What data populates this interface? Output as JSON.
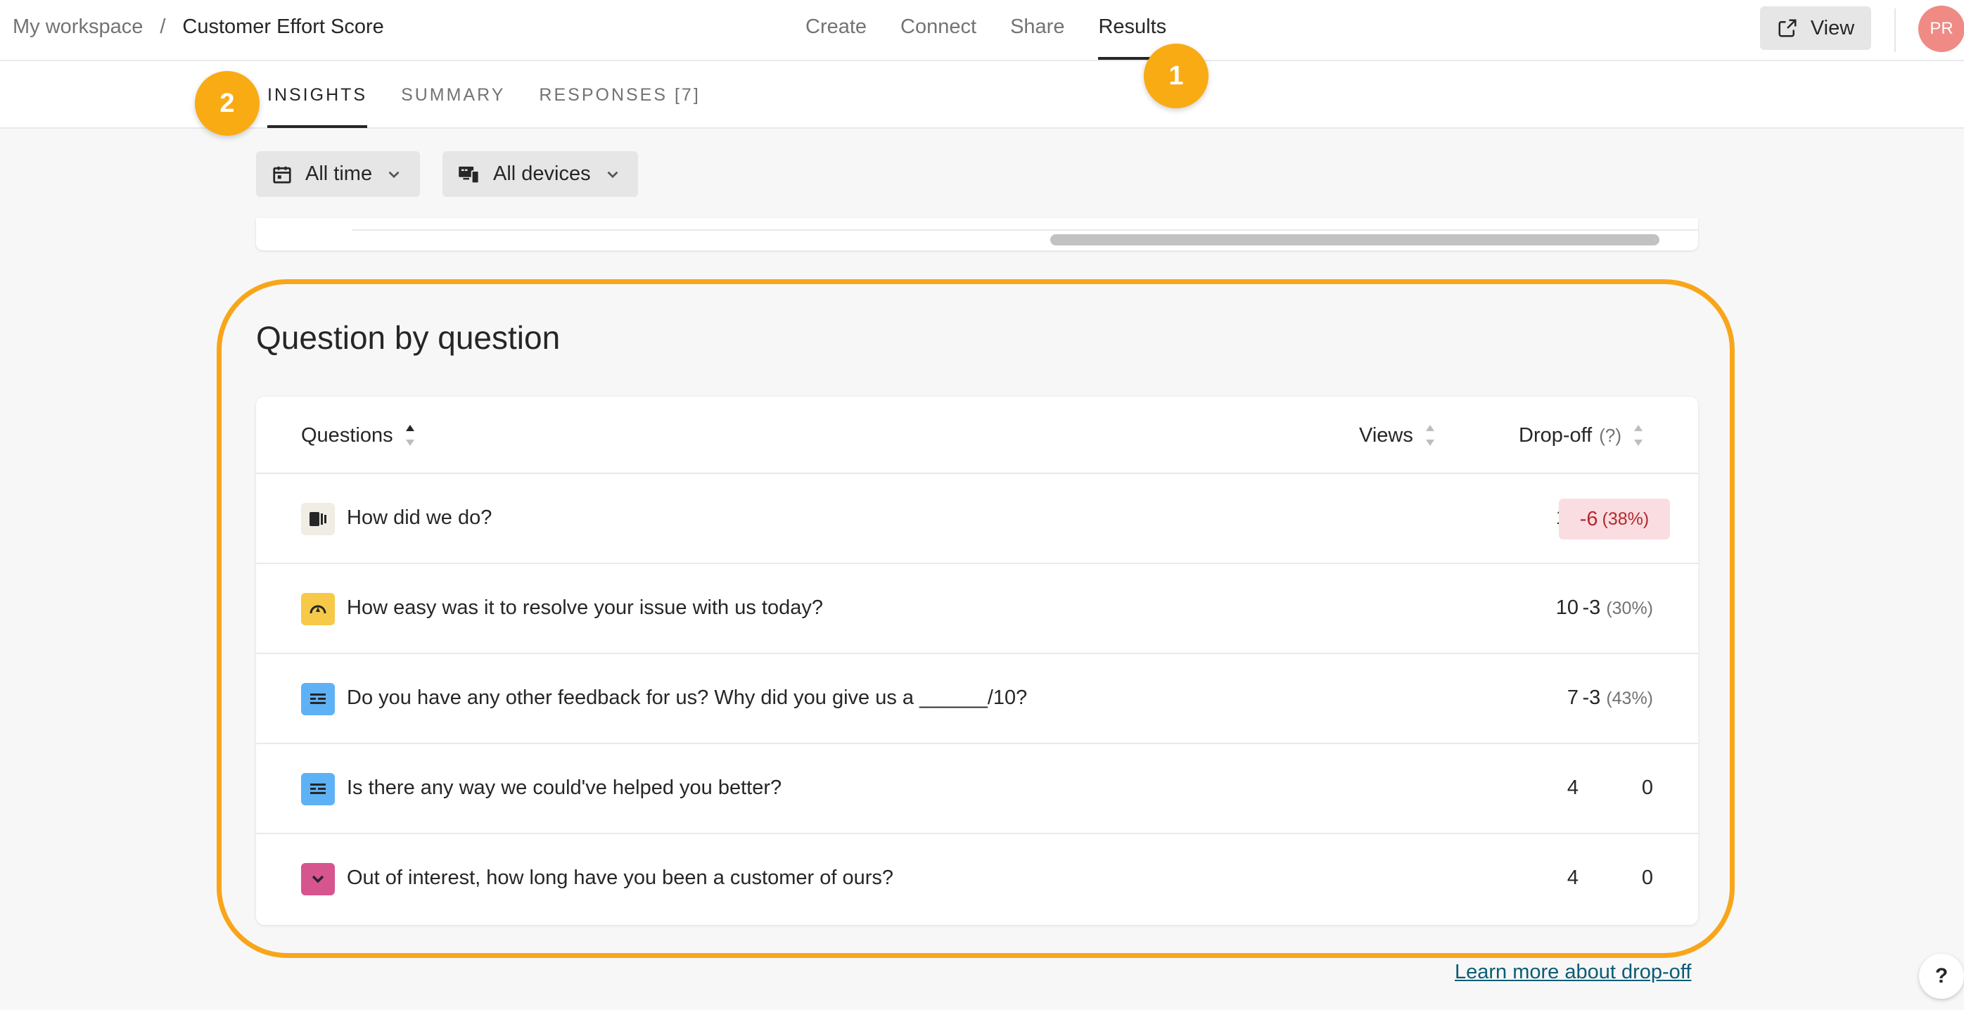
{
  "header": {
    "workspace": "My workspace",
    "separator": "/",
    "form_title": "Customer Effort Score",
    "nav": [
      "Create",
      "Connect",
      "Share",
      "Results"
    ],
    "active_nav": "Results",
    "view_label": "View",
    "avatar_initials": "PR"
  },
  "subnav": {
    "tabs": [
      "INSIGHTS",
      "SUMMARY",
      "RESPONSES [7]"
    ],
    "active_tab": "INSIGHTS"
  },
  "callouts": [
    "1",
    "2"
  ],
  "filters": {
    "time": "All time",
    "devices": "All devices"
  },
  "section": {
    "title": "Question by question",
    "columns": {
      "questions": "Questions",
      "views": "Views",
      "dropoff": "Drop-off",
      "dropoff_help": "(?)"
    },
    "rows": [
      {
        "icon": "opinion-scale-icon",
        "icon_color": "#f1ece4",
        "question": "How did we do?",
        "views": "16",
        "dropoff": "-6",
        "dropoff_pct": "(38%)",
        "highlight": true
      },
      {
        "icon": "rating-dial-icon",
        "icon_color": "#f7c948",
        "question": "How easy was it to resolve your issue with us today?",
        "views": "10",
        "dropoff": "-3",
        "dropoff_pct": "(30%)"
      },
      {
        "icon": "long-text-icon",
        "icon_color": "#5fb1f5",
        "question": "Do you have any other feedback for us? Why did you give us a ______/10?",
        "views": "7",
        "dropoff": "-3",
        "dropoff_pct": "(43%)"
      },
      {
        "icon": "long-text-icon",
        "icon_color": "#5fb1f5",
        "question": "Is there any way we could've helped you better?",
        "views": "4",
        "dropoff": "0",
        "dropoff_pct": ""
      },
      {
        "icon": "dropdown-icon",
        "icon_color": "#d6558f",
        "question": "Out of interest, how long have you been a customer of ours?",
        "views": "4",
        "dropoff": "0",
        "dropoff_pct": ""
      }
    ]
  },
  "footer": {
    "learn_more": "Learn more about drop-off",
    "help": "?"
  },
  "colors": {
    "accent_callout": "#f9ab14",
    "highlight_ring": "#f9a51a",
    "dropoff_badge_bg": "#fadde0",
    "dropoff_badge_text": "#b3282e"
  }
}
